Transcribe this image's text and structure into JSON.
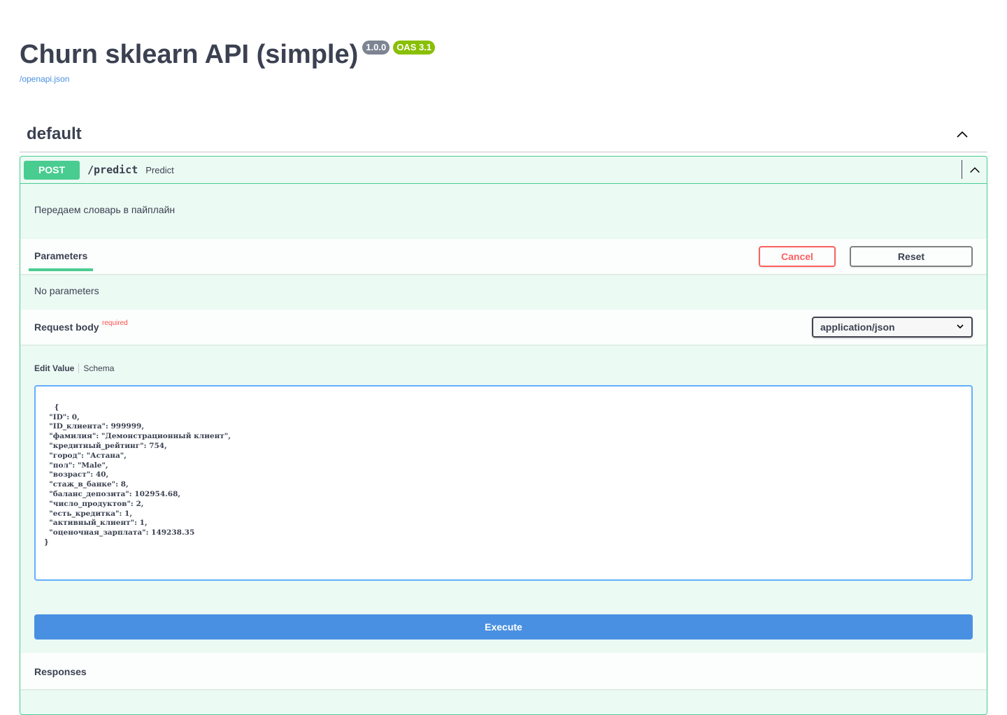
{
  "info": {
    "title": "Churn sklearn API (simple)",
    "version_badge": "1.0.0",
    "oas_badge": "OAS 3.1",
    "spec_link": "/openapi.json"
  },
  "tag": {
    "name": "default"
  },
  "operation": {
    "method": "POST",
    "path": "/predict",
    "summary": "Predict",
    "description": "Передаем словарь в пайплайн",
    "parameters_label": "Parameters",
    "cancel_label": "Cancel",
    "reset_label": "Reset",
    "no_parameters": "No parameters",
    "request_body_label": "Request body",
    "required_label": "required",
    "content_type": "application/json",
    "edit_value_label": "Edit Value",
    "schema_label": "Schema",
    "request_body_value": "{\n  \"ID\": 0,\n  \"ID_клиента\": 999999,\n  \"фамилия\": \"Демонстрационный клиент\",\n  \"кредитный_рейтинг\": 754,\n  \"город\": \"Астана\",\n  \"пол\": \"Male\",\n  \"возраст\": 40,\n  \"стаж_в_банке\": 8,\n  \"баланс_депозита\": 102954.68,\n  \"число_продуктов\": 2,\n  \"есть_кредитка\": 1,\n  \"активный_клиент\": 1,\n  \"оценочная_зарплата\": 149238.35\n}",
    "execute_label": "Execute",
    "responses_label": "Responses"
  },
  "colors": {
    "post_green": "#49cc90",
    "cancel_red": "#ff6060",
    "execute_blue": "#4990e2",
    "link_blue": "#4990e2",
    "version_badge_gray": "#7d8492",
    "oas_badge_green": "#89bf04"
  },
  "icons": {
    "tag_toggle": "chevron-up-icon",
    "operation_toggle": "chevron-up-icon",
    "select_arrow": "chevron-down-icon",
    "editor_resize": "resize-grip-icon"
  }
}
